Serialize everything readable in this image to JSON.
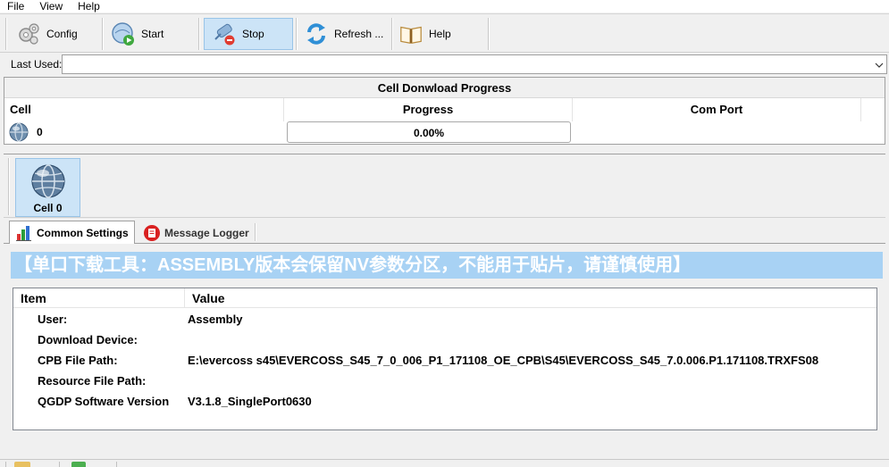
{
  "menu": {
    "file": "File",
    "view": "View",
    "help": "Help"
  },
  "toolbar": {
    "config": "Config",
    "start": "Start",
    "stop": "Stop",
    "refresh": "Refresh ...",
    "help": "Help"
  },
  "last_used": {
    "label": "Last Used:",
    "value": ""
  },
  "progress_panel": {
    "title": "Cell Donwload Progress",
    "columns": [
      "Cell",
      "Progress",
      "Com Port"
    ],
    "row": {
      "cell": "0",
      "progress": "0.00%",
      "com_port": ""
    }
  },
  "cells": [
    {
      "label": "Cell 0"
    }
  ],
  "tabs": [
    {
      "label": "Common Settings",
      "active": true
    },
    {
      "label": "Message Logger",
      "active": false
    }
  ],
  "warning_text": "【单口下载工具：ASSEMBLY版本会保留NV参数分区，不能用于贴片，请谨慎使用】",
  "settings_grid": {
    "headers": [
      "Item",
      "Value"
    ],
    "rows": [
      {
        "item": "User:",
        "value": "Assembly"
      },
      {
        "item": "Download Device:",
        "value": ""
      },
      {
        "item": "CPB File Path:",
        "value": "E:\\evercoss s45\\EVERCOSS_S45_7_0_006_P1_171108_OE_CPB\\S45\\EVERCOSS_S45_7.0.006.P1.171108.TRXFS08"
      },
      {
        "item": "Resource File Path:",
        "value": ""
      },
      {
        "item": "QGDP Software Version",
        "value": "V3.1.8_SinglePort0630"
      }
    ]
  },
  "colors": {
    "warning_bg": "#a8d2f4",
    "selected_bg": "#cce4f7",
    "window_bg": "#f0f0f0"
  }
}
